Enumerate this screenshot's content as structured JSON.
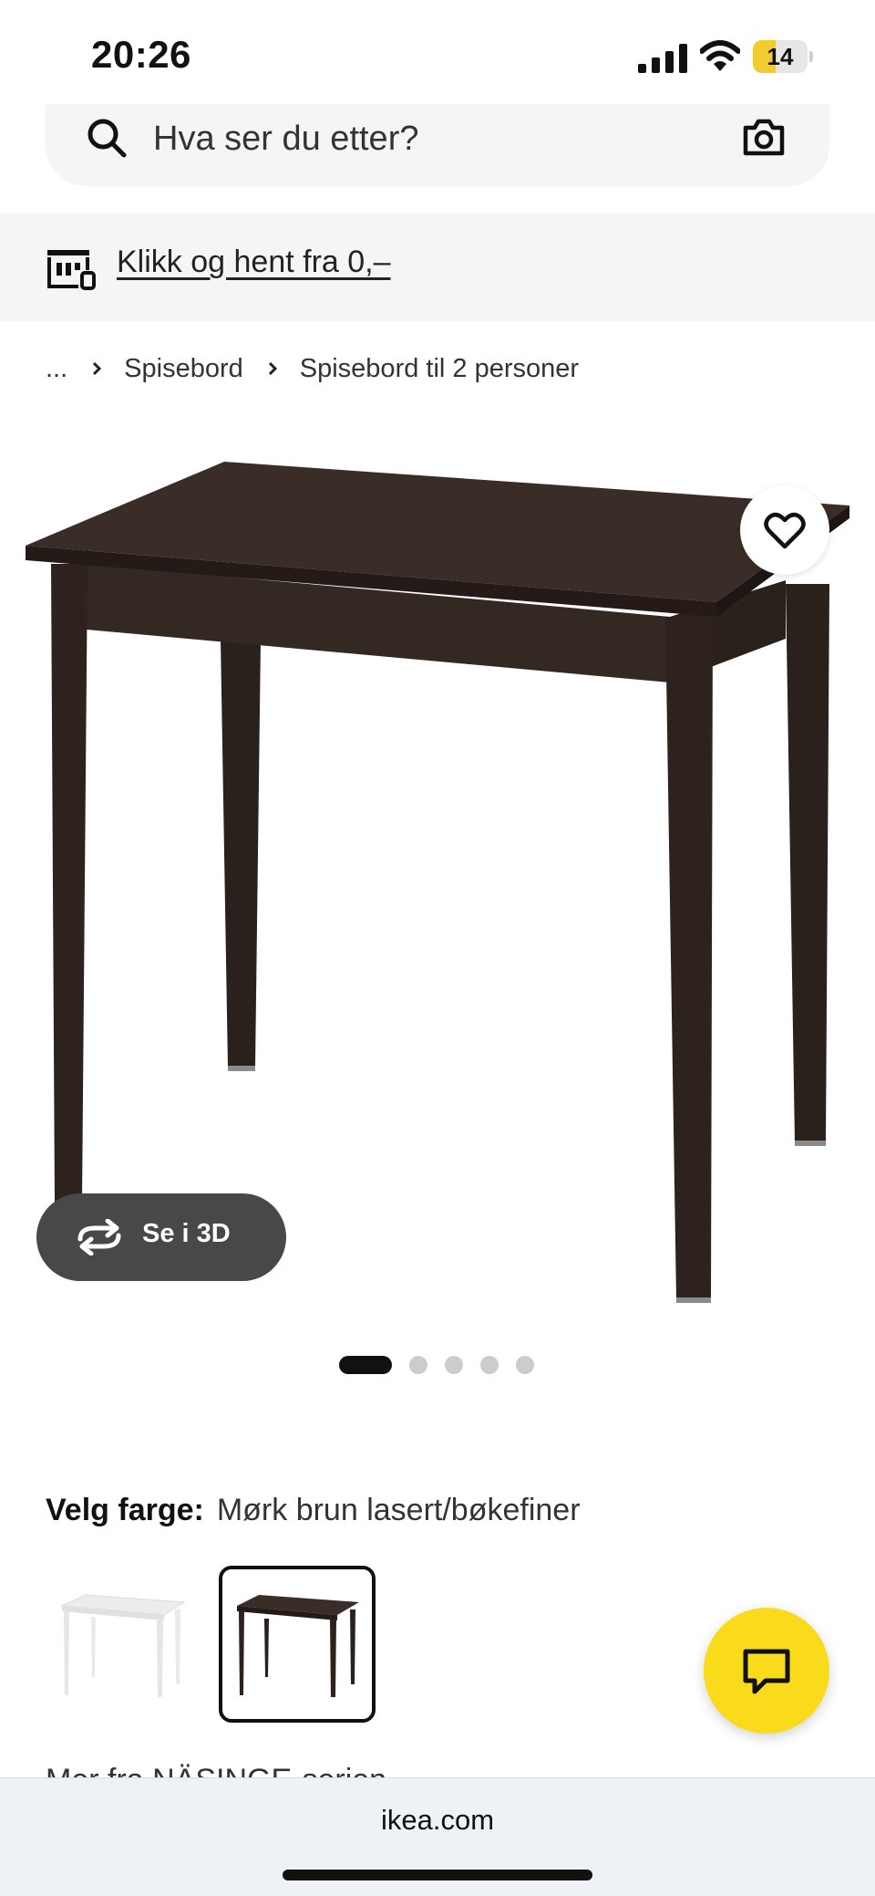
{
  "status_bar": {
    "time": "20:26",
    "battery": "14",
    "battery_level": 0.14
  },
  "search": {
    "placeholder": "Hva ser du etter?",
    "icon": "search-icon",
    "camera_icon": "camera-icon"
  },
  "banner": {
    "icon": "store-icon",
    "text": "Klikk og hent fra 0,–"
  },
  "breadcrumb": {
    "ellipsis": "...",
    "items": [
      "Spisebord",
      "Spisebord til 2 personer"
    ]
  },
  "product": {
    "favorite_icon": "heart-icon",
    "see_3d_label": "Se i 3D",
    "see_3d_icon": "rotate-icon",
    "image_count": 5,
    "active_image": 1
  },
  "color": {
    "label": "Velg farge:",
    "value": "Mørk brun lasert/bøkefiner",
    "options": [
      {
        "name": "white",
        "color": "#ffffff",
        "selected": false
      },
      {
        "name": "dark-brown",
        "color": "#2f2420",
        "selected": true
      }
    ]
  },
  "series": {
    "text": "Mer fra NÄSINGE-serien"
  },
  "chat": {
    "icon": "chat-icon"
  },
  "browser": {
    "url": "ikea.com"
  },
  "colors": {
    "ikea_yellow": "#fadb1b",
    "table_dark": "#2f2420",
    "pill_bg": "#484848"
  }
}
